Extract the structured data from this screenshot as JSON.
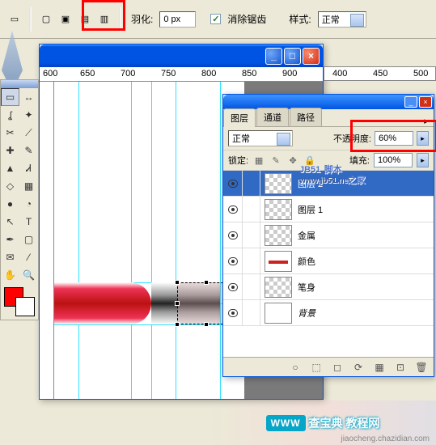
{
  "toolbar": {
    "feather_label": "羽化:",
    "feather_value": "0 px",
    "antialias_label": "消除锯齿",
    "antialias_checked": true,
    "style_label": "样式:",
    "style_value": "正常"
  },
  "ruler_h": [
    "600",
    "650",
    "700",
    "750",
    "800",
    "850",
    "900"
  ],
  "ruler_h2": [
    "400",
    "450",
    "500"
  ],
  "window_controls": {
    "min": "_",
    "max": "□",
    "close": "×"
  },
  "tools": [
    {
      "name": "marquee",
      "glyph": "▭"
    },
    {
      "name": "move",
      "glyph": "↔"
    },
    {
      "name": "lasso",
      "glyph": "ʆ"
    },
    {
      "name": "wand",
      "glyph": "✦"
    },
    {
      "name": "crop",
      "glyph": "✂"
    },
    {
      "name": "slice",
      "glyph": "⟋"
    },
    {
      "name": "heal",
      "glyph": "✚"
    },
    {
      "name": "brush",
      "glyph": "✎"
    },
    {
      "name": "stamp",
      "glyph": "▲"
    },
    {
      "name": "history",
      "glyph": "Ꮧ"
    },
    {
      "name": "eraser",
      "glyph": "◇"
    },
    {
      "name": "gradient",
      "glyph": "▦"
    },
    {
      "name": "blur",
      "glyph": "●"
    },
    {
      "name": "dodge",
      "glyph": "◔"
    },
    {
      "name": "path",
      "glyph": "↖"
    },
    {
      "name": "type",
      "glyph": "T"
    },
    {
      "name": "pen",
      "glyph": "✒"
    },
    {
      "name": "shape",
      "glyph": "▢"
    },
    {
      "name": "notes",
      "glyph": "✉"
    },
    {
      "name": "eyedrop",
      "glyph": "⁄"
    },
    {
      "name": "hand",
      "glyph": "✋"
    },
    {
      "name": "zoom",
      "glyph": "🔍"
    }
  ],
  "colors": {
    "fg": "#ff0000",
    "bg": "#ffffff"
  },
  "layers_panel": {
    "tabs": [
      "图层",
      "通道",
      "路径"
    ],
    "active_tab": 0,
    "blend_mode": "正常",
    "opacity_label": "不透明度:",
    "opacity_value": "60%",
    "lock_label": "锁定:",
    "fill_label": "填充:",
    "fill_value": "100%",
    "layers": [
      {
        "name": "图层 2",
        "thumb": "checker",
        "selected": true,
        "visible": true
      },
      {
        "name": "图层 1",
        "thumb": "checker",
        "selected": false,
        "visible": true
      },
      {
        "name": "金属",
        "thumb": "checker",
        "selected": false,
        "visible": true
      },
      {
        "name": "颜色",
        "thumb": "redstroke",
        "selected": false,
        "visible": true
      },
      {
        "name": "笔身",
        "thumb": "checker",
        "selected": false,
        "visible": true
      },
      {
        "name": "背景",
        "thumb": "bg",
        "selected": false,
        "visible": true,
        "italic": true
      }
    ],
    "footer_icons": [
      "○",
      "⬚",
      "◻",
      "⟳",
      "▦",
      "⊡",
      "🗑"
    ]
  },
  "watermark": {
    "brand": "JB51",
    "sub1": "脚本",
    "sub2": "之家",
    "url": "www.jb51.net"
  },
  "bottom_watermark": {
    "badge": "WWW",
    "text": "查宝典 教程网",
    "url": "jiaocheng.chazidian.com"
  }
}
